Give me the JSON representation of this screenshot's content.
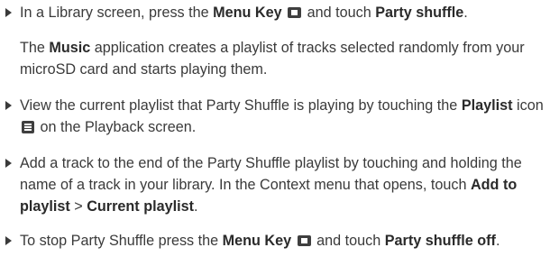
{
  "items": [
    {
      "t1": "In a Library screen, press the ",
      "b1": "Menu Key",
      "icon1": "menu-key-icon",
      "t2": " and touch ",
      "b2": "Party shuffle",
      "t3": "."
    },
    {
      "b1": "Music",
      "t1": " application creates a playlist of tracks selected randomly from your microSD card and starts playing them.",
      "t0": "The "
    },
    {
      "t1": "View the current playlist that Party Shuffle is playing by touching the ",
      "b1": "Playlist",
      "t2": " icon ",
      "icon1": "playlist-icon",
      "t3": " on the Playback screen."
    },
    {
      "t1": "Add a track to the end of the Party Shuffle playlist by touching and holding the name of a track in your library. In the Context menu that opens, touch ",
      "b1": "Add to playlist",
      "t2": " > ",
      "b2": "Current playlist",
      "t3": "."
    },
    {
      "t1": "To stop Party Shuffle press the ",
      "b1": "Menu Key",
      "icon1": "menu-key-icon",
      "t2": " and touch ",
      "b2": "Party shuffle off",
      "t3": "."
    }
  ]
}
